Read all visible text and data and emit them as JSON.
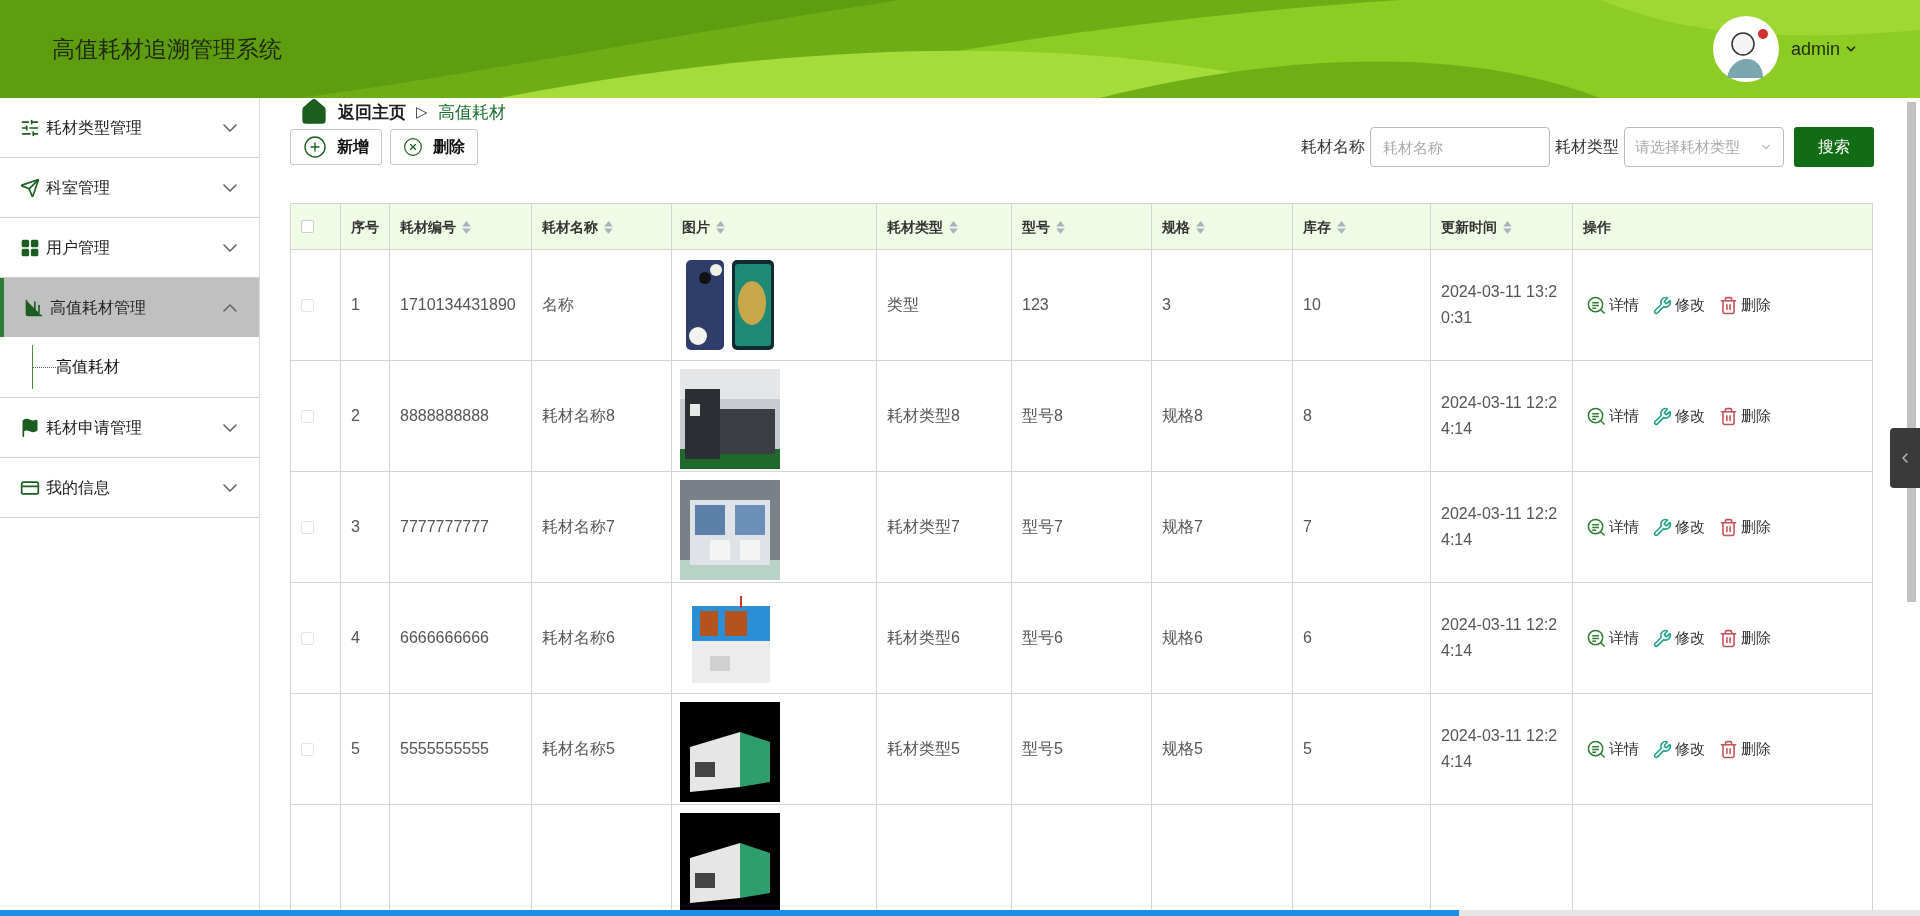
{
  "header": {
    "title": "高值耗材追溯管理系统",
    "user": "admin"
  },
  "sidebar": {
    "items": [
      {
        "label": "耗材类型管理",
        "expanded": false,
        "selected": false
      },
      {
        "label": "科室管理",
        "expanded": false,
        "selected": false
      },
      {
        "label": "用户管理",
        "expanded": false,
        "selected": false
      },
      {
        "label": "高值耗材管理",
        "expanded": true,
        "selected": true,
        "children": [
          {
            "label": "高值耗材"
          }
        ]
      },
      {
        "label": "耗材申请管理",
        "expanded": false,
        "selected": false
      },
      {
        "label": "我的信息",
        "expanded": false,
        "selected": false
      }
    ]
  },
  "breadcrumb": {
    "home": "返回主页",
    "separator": "▷",
    "current": "高值耗材"
  },
  "toolbar": {
    "buttons": [
      {
        "kind": "add",
        "label": "新增"
      },
      {
        "kind": "remove",
        "label": "删除"
      }
    ],
    "name_label": "耗材名称",
    "name_placeholder": "耗材名称",
    "type_label": "耗材类型",
    "type_placeholder": "请选择耗材类型",
    "search": "搜索"
  },
  "table": {
    "select_all": {
      "checked": false
    },
    "columns": [
      {
        "label": "序号",
        "sortable": false
      },
      {
        "label": "耗材编号",
        "sortable": true
      },
      {
        "label": "耗材名称",
        "sortable": true
      },
      {
        "label": "图片",
        "sortable": true
      },
      {
        "label": "耗材类型",
        "sortable": true
      },
      {
        "label": "型号",
        "sortable": true
      },
      {
        "label": "规格",
        "sortable": true
      },
      {
        "label": "库存",
        "sortable": true
      },
      {
        "label": "更新时间",
        "sortable": true
      },
      {
        "label": "操作",
        "sortable": false
      }
    ],
    "rows": [
      {
        "kind": "full",
        "checked": false,
        "cells": [
          "1",
          "1710134431890",
          "名称",
          "类型",
          "123",
          "3",
          "10",
          "2024-03-11 13:20:31"
        ],
        "actions": [
          "详情",
          "修改",
          "删除"
        ]
      },
      {
        "kind": "full",
        "checked": false,
        "cells": [
          "2",
          "8888888888",
          "耗材名称8",
          "耗材类型8",
          "型号8",
          "规格8",
          "8",
          "2024-03-11 12:24:14"
        ],
        "actions": [
          "详情",
          "修改",
          "删除"
        ]
      },
      {
        "kind": "full",
        "checked": false,
        "cells": [
          "3",
          "7777777777",
          "耗材名称7",
          "耗材类型7",
          "型号7",
          "规格7",
          "7",
          "2024-03-11 12:24:14"
        ],
        "actions": [
          "详情",
          "修改",
          "删除"
        ]
      },
      {
        "kind": "full",
        "checked": false,
        "cells": [
          "4",
          "6666666666",
          "耗材名称6",
          "耗材类型6",
          "型号6",
          "规格6",
          "6",
          "2024-03-11 12:24:14"
        ],
        "actions": [
          "详情",
          "修改",
          "删除"
        ]
      },
      {
        "kind": "full",
        "checked": false,
        "cells": [
          "5",
          "5555555555",
          "耗材名称5",
          "耗材类型5",
          "型号5",
          "规格5",
          "5",
          "2024-03-11 12:24:14"
        ],
        "actions": [
          "详情",
          "修改",
          "删除"
        ]
      },
      {
        "kind": "partial"
      }
    ]
  },
  "playback_bar": {
    "level": 0.76
  }
}
